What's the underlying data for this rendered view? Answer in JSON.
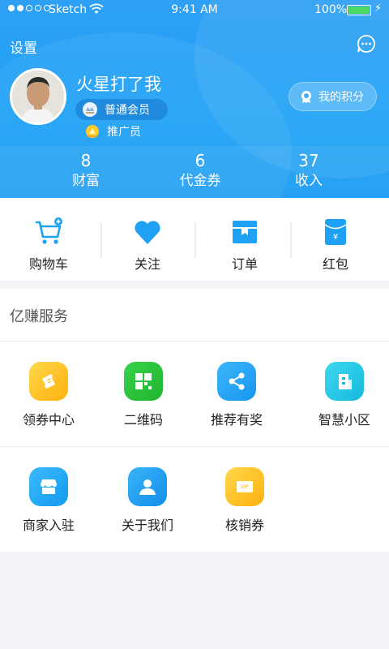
{
  "status_bar": {
    "carrier": "Sketch",
    "time": "9:41 AM",
    "battery": "100%"
  },
  "header": {
    "settings_label": "设置",
    "username": "火星打了我",
    "member_level": "普通会员",
    "role": "推广员",
    "points_label": "我的积分"
  },
  "stats": [
    {
      "value": "8",
      "label": "财富"
    },
    {
      "value": "6",
      "label": "代金券"
    },
    {
      "value": "37",
      "label": "收入"
    }
  ],
  "quick_actions": [
    {
      "label": "购物车",
      "icon": "cart-icon"
    },
    {
      "label": "关注",
      "icon": "heart-icon"
    },
    {
      "label": "订单",
      "icon": "order-box-icon"
    },
    {
      "label": "红包",
      "icon": "red-envelope-icon"
    }
  ],
  "services": {
    "title": "亿赚服务",
    "items": [
      {
        "label": "领券中心",
        "icon": "ticket-icon",
        "color": "#ffc21f"
      },
      {
        "label": "二维码",
        "icon": "qr-code-icon",
        "color": "#27c43a"
      },
      {
        "label": "推荐有奖",
        "icon": "share-icon",
        "color": "#23a6f5"
      },
      {
        "label": "智慧小区",
        "icon": "building-icon",
        "color": "#24c6e6"
      },
      {
        "label": "商家入驻",
        "icon": "store-icon",
        "color": "#21a8f3"
      },
      {
        "label": "关于我们",
        "icon": "person-icon",
        "color": "#1f9ff1"
      },
      {
        "label": "核销券",
        "icon": "vip-card-icon",
        "color": "#ffc21f"
      }
    ]
  },
  "colors": {
    "accent": "#1fa2f6",
    "page_bg": "#f2f4f7"
  }
}
